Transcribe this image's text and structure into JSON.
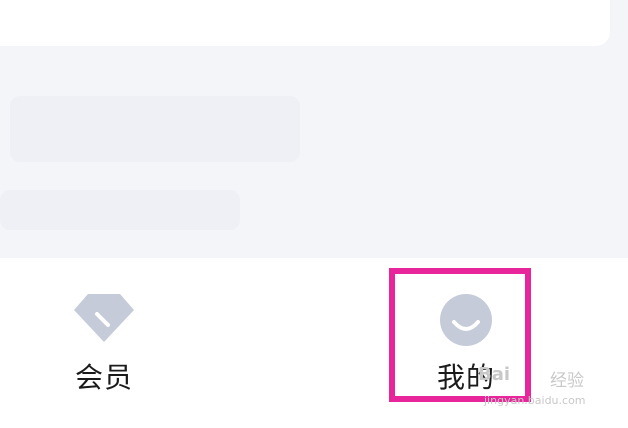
{
  "tab_bar": {
    "items": [
      {
        "label": "会员",
        "icon": "diamond-icon",
        "icon_color": "#c5cbd8"
      },
      {
        "label": "我的",
        "icon": "smiley-face-icon",
        "icon_color": "#c5cbd8"
      }
    ]
  },
  "highlight_color": "#e8259a",
  "watermark": {
    "logo": "Bai",
    "text": "经验",
    "url": "jingyan.baidu.com"
  }
}
